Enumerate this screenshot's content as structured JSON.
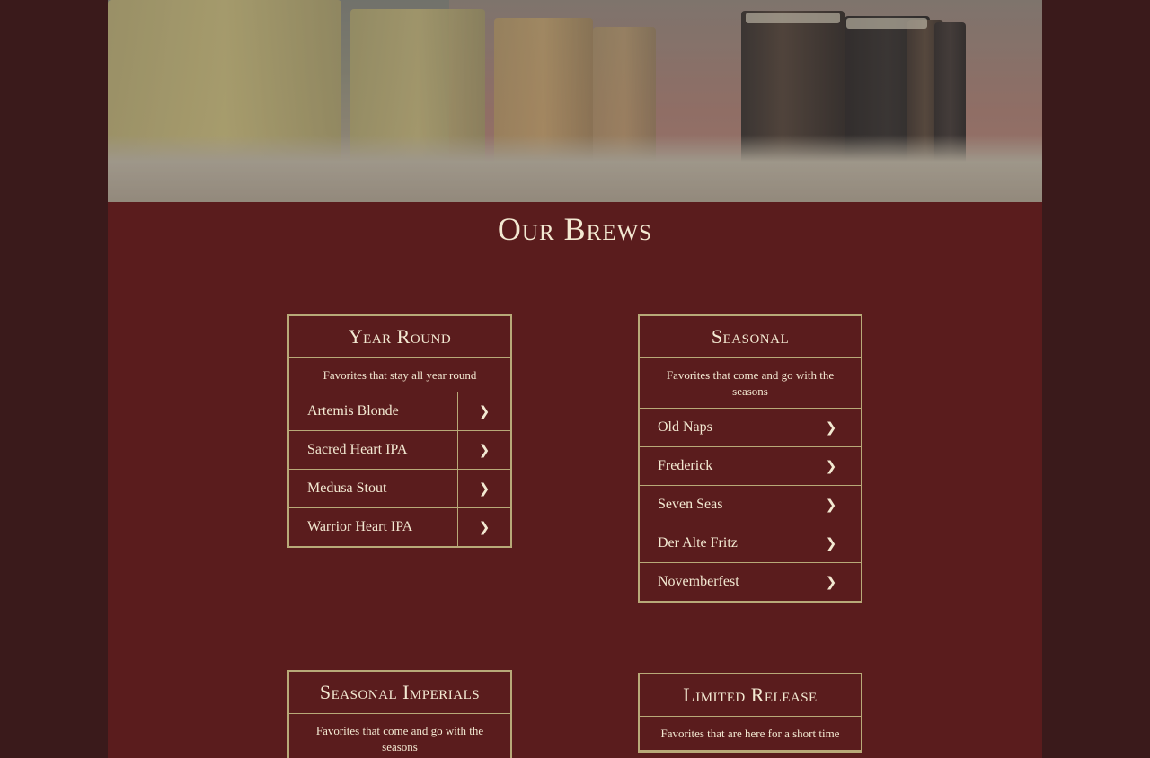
{
  "section_title": "Our Brews",
  "arrow_glyph": "❯",
  "cards": {
    "year_round": {
      "title": "Year Round",
      "description": "Favorites that stay all year round",
      "beers": [
        "Artemis Blonde",
        "Sacred Heart IPA",
        "Medusa Stout",
        "Warrior Heart IPA"
      ]
    },
    "seasonal": {
      "title": "Seasonal",
      "description": "Favorites that come and go with the seasons",
      "beers": [
        "Old Naps",
        "Frederick",
        "Seven Seas",
        "Der Alte Fritz",
        "Novemberfest"
      ]
    },
    "seasonal_imperials": {
      "title": "Seasonal Imperials",
      "description": "Favorites that come and go with the seasons",
      "beers": []
    },
    "limited_release": {
      "title": "Limited Release",
      "description": "Favorites that are here for a short time",
      "beers": []
    }
  },
  "colors": {
    "background_outer": "#3a1a1b",
    "background_panel": "#5a1c1d",
    "border_gold": "#b8a978",
    "text_cream": "#f3e9d2"
  }
}
